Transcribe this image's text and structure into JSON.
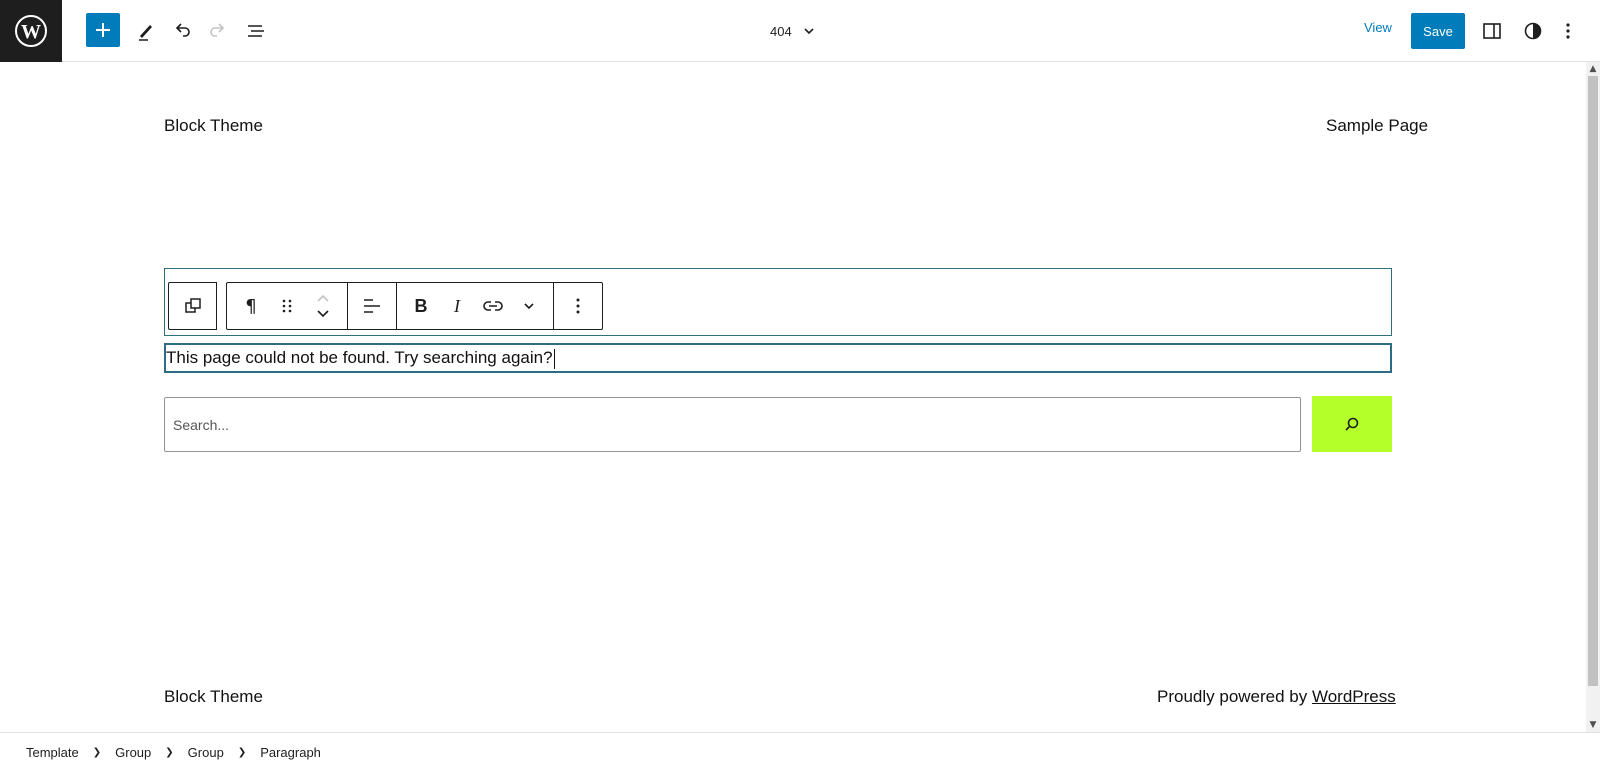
{
  "topbar": {
    "document_title": "404",
    "view_label": "View",
    "save_label": "Save"
  },
  "header": {
    "site_title": "Block Theme",
    "nav_item": "Sample Page"
  },
  "content": {
    "paragraph_text": "This page could not be found. Try searching again?",
    "search_placeholder": "Search...",
    "search_button_color": "#b4ff2a"
  },
  "footer": {
    "site_title": "Block Theme",
    "credit_prefix": "Proudly powered by ",
    "credit_link": "WordPress"
  },
  "breadcrumb": [
    "Template",
    "Group",
    "Group",
    "Paragraph"
  ],
  "colors": {
    "accent": "#007cba",
    "dark": "#1e1e1e",
    "selection_outline": "#2d6c87"
  }
}
